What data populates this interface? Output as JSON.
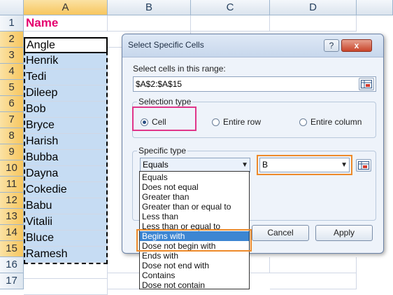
{
  "columns": [
    "A",
    "B",
    "C",
    "D"
  ],
  "rows": [
    "1",
    "2",
    "3",
    "4",
    "5",
    "6",
    "7",
    "8",
    "9",
    "10",
    "11",
    "12",
    "13",
    "14",
    "15",
    "16",
    "17"
  ],
  "column_a_values": [
    "Name",
    "Angle",
    "Henrik",
    "Tedi",
    "Dileep",
    "Bob",
    "Bryce",
    "Harish",
    "Bubba",
    "Dayna",
    "Cokedie",
    "Babu",
    "Vitalii",
    "Bluce",
    "Ramesh",
    "",
    ""
  ],
  "dialog": {
    "title": "Select Specific Cells",
    "help_label": "?",
    "close_label": "x",
    "range_label": "Select cells in this range:",
    "range_value": "$A$2:$A$15",
    "selection_type": {
      "legend": "Selection type",
      "options": [
        "Cell",
        "Entire row",
        "Entire column"
      ],
      "selected": "Cell"
    },
    "specific_type": {
      "legend": "Specific type",
      "operator_selected": "Equals",
      "value": "B",
      "options": [
        "Equals",
        "Does not equal",
        "Greater than",
        "Greater than or equal to",
        "Less than",
        "Less than or equal to",
        "Begins with",
        "Dose not begin with",
        "Ends with",
        "Dose not end with",
        "Contains",
        "Dose not contain"
      ],
      "highlighted": "Begins with"
    },
    "cancel_label": "Cancel",
    "apply_label": "Apply"
  },
  "colors": {
    "title_text": "#e5006e",
    "selection_fill": "#c6dcf3",
    "highlight_pink": "#e0368a",
    "highlight_orange": "#ee8a2a",
    "list_highlight": "#3d86d2"
  },
  "icons": [
    "range-picker-icon",
    "dropdown-arrow-icon",
    "radio-icon"
  ]
}
